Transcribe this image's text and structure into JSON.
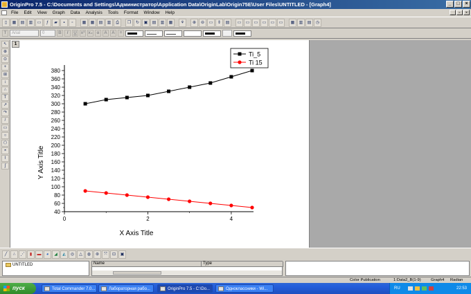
{
  "window": {
    "title": "OriginPro 7.5 - C:\\Documents and Settings\\Администратор\\Application Data\\OriginLab\\Origin75E\\User Files\\UNTITLED - [Graph4]",
    "minimize_label": "_",
    "maximize_label": "□",
    "close_label": "×"
  },
  "menu": [
    "File",
    "Edit",
    "View",
    "Graph",
    "Data",
    "Analysis",
    "Tools",
    "Format",
    "Window",
    "Help"
  ],
  "format_toolbar": {
    "font_value": "Arial",
    "size_value": "0",
    "bold_label": "B",
    "italic_label": "I",
    "underline_label": "U"
  },
  "graph": {
    "layer_number": "1"
  },
  "chart_data": {
    "type": "line",
    "xlabel": "X Axis Title",
    "ylabel": "Y Axis Title",
    "xlim": [
      0,
      4.5
    ],
    "ylim": [
      40,
      390
    ],
    "xticks": [
      0,
      2,
      4
    ],
    "yticks": [
      40,
      60,
      80,
      100,
      120,
      140,
      160,
      180,
      200,
      220,
      240,
      260,
      280,
      300,
      320,
      340,
      360,
      380
    ],
    "series": [
      {
        "name": "Ti_5",
        "color": "#000000",
        "marker": "square",
        "x": [
          0.5,
          1.0,
          1.5,
          2.0,
          2.5,
          3.0,
          3.5,
          4.0,
          4.5
        ],
        "y": [
          300,
          310,
          315,
          320,
          330,
          340,
          350,
          365,
          380
        ]
      },
      {
        "name": "Ti 15",
        "color": "#ff0000",
        "marker": "circle",
        "x": [
          0.5,
          1.0,
          1.5,
          2.0,
          2.5,
          3.0,
          3.5,
          4.0,
          4.5
        ],
        "y": [
          90,
          85,
          80,
          75,
          70,
          65,
          60,
          55,
          50
        ]
      }
    ],
    "legend_position": "top-right",
    "grid": false
  },
  "explorer": {
    "folder": "UNTITLED",
    "col_name": "Name",
    "col_type": "Type"
  },
  "status": {
    "mode": "Color Publication",
    "dataset": "1:Data2_B(1-9)",
    "window": "Graph4",
    "angle": "Radian"
  },
  "taskbar": {
    "start_label": "пуск",
    "tasks": [
      "Total Commander 7.0...",
      "Лабораторная рабо...",
      "OriginPro 7.5 - C:\\Do...",
      "Одноклассники - Wi..."
    ],
    "lang": "RU",
    "clock": "22:53"
  }
}
